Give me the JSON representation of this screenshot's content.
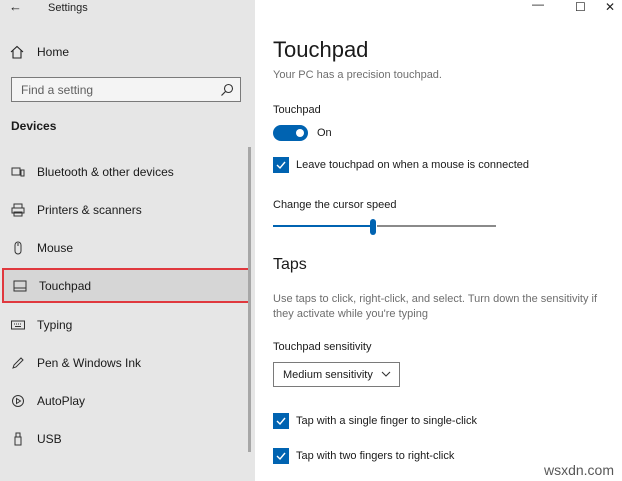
{
  "window": {
    "title": "Settings",
    "back_glyph": "←",
    "minimize_glyph": "—",
    "maximize_glyph": "☐",
    "close_glyph": "✕"
  },
  "sidebar": {
    "home_label": "Home",
    "search_placeholder": "Find a setting",
    "section_title": "Devices",
    "items": [
      {
        "label": "Bluetooth & other devices",
        "icon": "bluetooth-icon"
      },
      {
        "label": "Printers & scanners",
        "icon": "printer-icon"
      },
      {
        "label": "Mouse",
        "icon": "mouse-icon"
      },
      {
        "label": "Touchpad",
        "icon": "touchpad-icon",
        "selected": true
      },
      {
        "label": "Typing",
        "icon": "keyboard-icon"
      },
      {
        "label": "Pen & Windows Ink",
        "icon": "pen-icon"
      },
      {
        "label": "AutoPlay",
        "icon": "autoplay-icon"
      },
      {
        "label": "USB",
        "icon": "usb-icon"
      }
    ]
  },
  "main": {
    "title": "Touchpad",
    "subtitle": "Your PC has a precision touchpad.",
    "touchpad_label": "Touchpad",
    "toggle_state": "On",
    "leave_on_label": "Leave touchpad on when a mouse is connected",
    "cursor_speed_label": "Change the cursor speed",
    "cursor_speed_fraction": 0.44,
    "taps_heading": "Taps",
    "taps_description": "Use taps to click, right-click, and select. Turn down the sensitivity if they activate while you're typing",
    "sensitivity_label": "Touchpad sensitivity",
    "sensitivity_value": "Medium sensitivity",
    "single_tap_label": "Tap with a single finger to single-click",
    "two_finger_label": "Tap with two fingers to right-click"
  },
  "watermark": "wsxdn.com",
  "colors": {
    "accent": "#0063b1",
    "selection_border": "#e0383e",
    "sidebar_bg": "#e6e6e6"
  }
}
